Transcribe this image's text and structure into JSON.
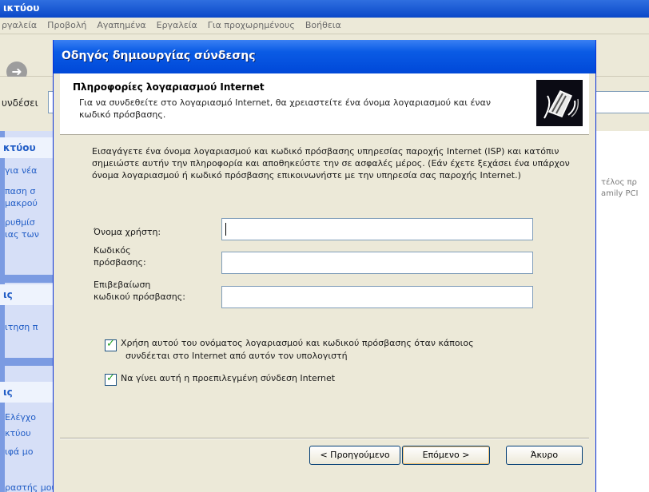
{
  "background_window": {
    "title": "ικτύου",
    "menu": [
      "ργαλεία",
      "Προβολή",
      "Αγαπημένα",
      "Εργαλεία",
      "Για προχωρημένους",
      "Βοήθεια"
    ],
    "address_label": "υνδέσει",
    "sidebar_headers": [
      "κτύου",
      "ις",
      "ις"
    ],
    "sidebar_links": [
      "για νέα",
      "παση σ",
      "μακρού",
      "ρυθμίσ",
      "ιας των",
      "ιτηση π",
      "Ελέγχο",
      "κτύου",
      "ιφά μο",
      "ραστής μου"
    ],
    "right_text": [
      "τέλος πρ",
      "amily PCI"
    ]
  },
  "dialog": {
    "title": "Οδηγός δημιουργίας σύνδεσης",
    "header_title": "Πληροφορίες λογαριασμού Internet",
    "header_subtitle": "Για να συνδεθείτε στο λογαριασμό Internet, θα χρειαστείτε ένα όνομα λογαριασμού και έναν κωδικό πρόσβασης.",
    "intro": "Εισαγάγετε ένα όνομα λογαριασμού και κωδικό πρόσβασης υπηρεσίας παροχής Internet (ISP) και κατόπιν σημειώστε αυτήν την πληροφορία και αποθηκεύστε την σε ασφαλές μέρος. (Εάν έχετε ξεχάσει ένα υπάρχον όνομα λογαριασμού ή κωδικό πρόσβασης επικοινωνήστε με την υπηρεσία σας παροχής Internet.)",
    "fields": {
      "username": {
        "label": "Όνομα χρήστη:",
        "value": ""
      },
      "password": {
        "label_line1": "Κωδικός",
        "label_line2": "πρόσβασης:",
        "value": ""
      },
      "confirm": {
        "label_line1": "Επιβεβαίωση",
        "label_line2": "κωδικού πρόσβασης:",
        "value": ""
      }
    },
    "checkboxes": {
      "use_for_all": {
        "checked": true,
        "text_line1": "Χρήση αυτού του ονόματος λογαριασμού και κωδικού πρόσβασης όταν κάποιος",
        "text_line2": "συνδέεται στο Internet από αυτόν τον υπολογιστή"
      },
      "default_connection": {
        "checked": true,
        "text": "Να γίνει αυτή η προεπιλεγμένη σύνδεση Internet"
      }
    },
    "buttons": {
      "back": "< Προηγούμενο",
      "next": "Επόμενο >",
      "cancel": "Άκυρο"
    }
  }
}
